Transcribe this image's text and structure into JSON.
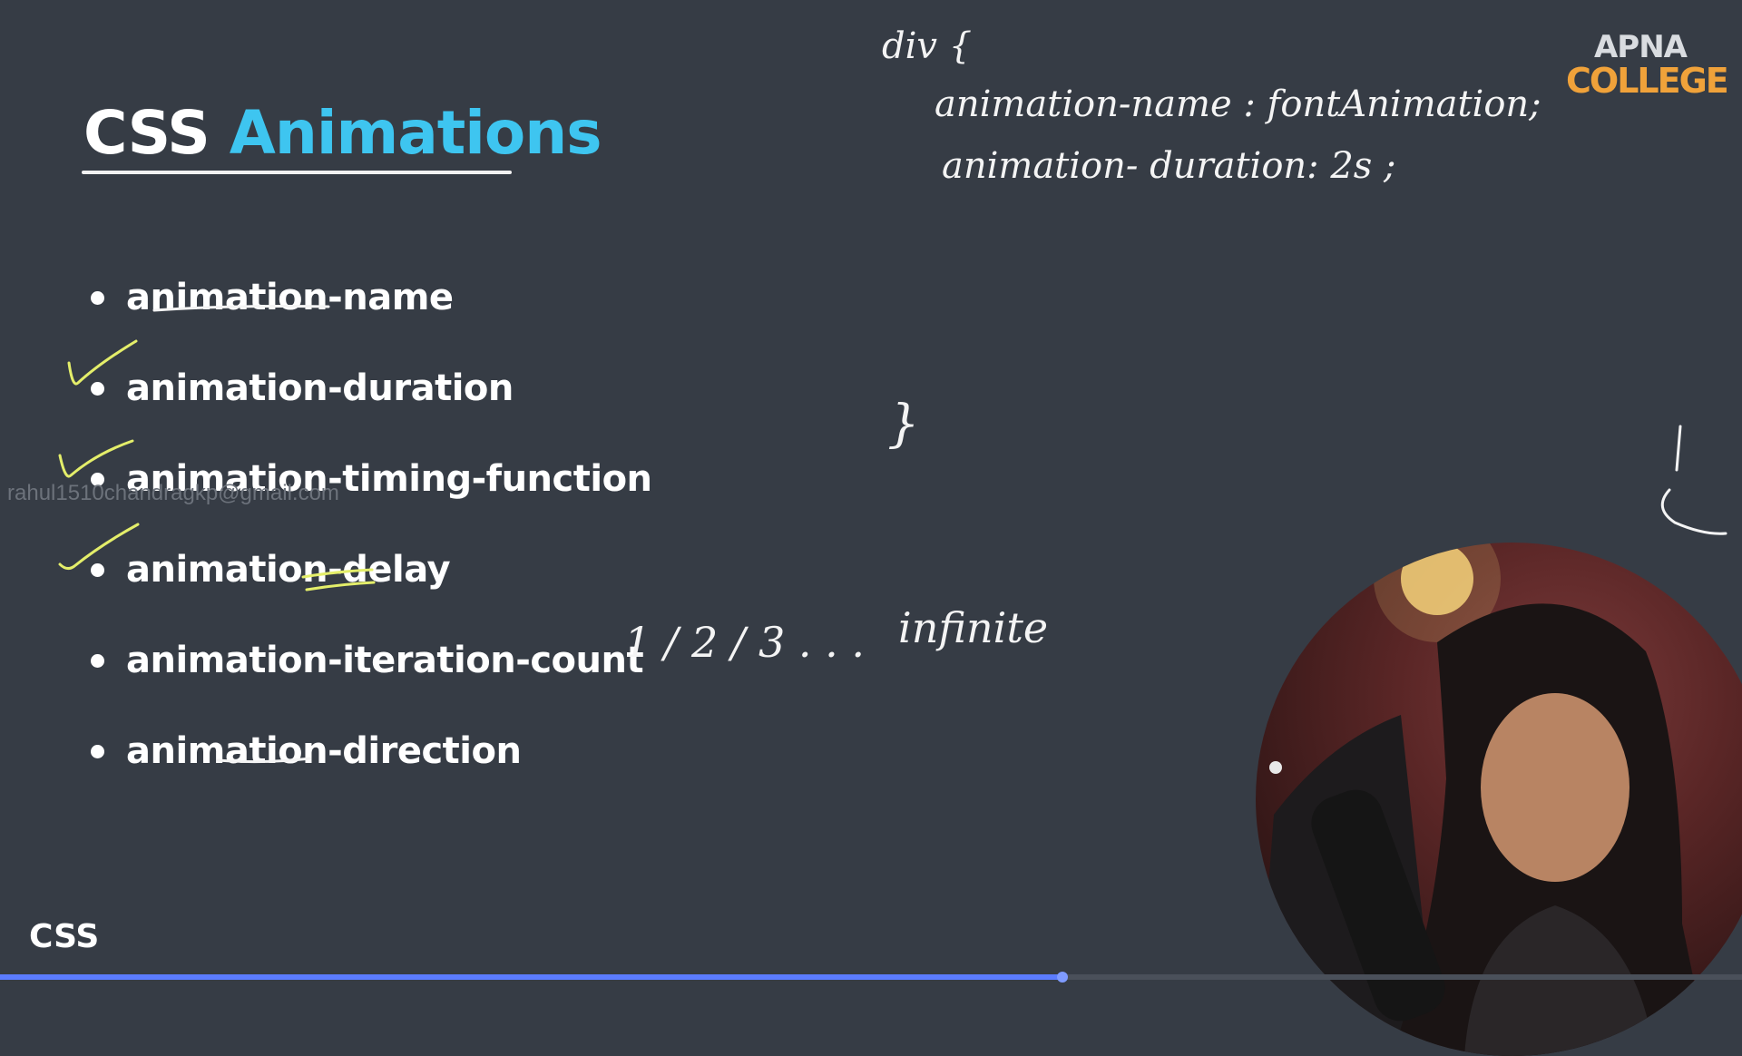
{
  "slide": {
    "title_main": "CSS",
    "title_highlight": "Animations",
    "properties": [
      "animation-name",
      "animation-duration",
      "animation-timing-function",
      "animation-delay",
      "animation-iteration-count",
      "animation-direction"
    ],
    "footer_label": "CSS",
    "watermark_email": "rahul1510chandragkp@gmail.com"
  },
  "logo": {
    "line1": "APNA",
    "line2": "COLLEGE"
  },
  "handwriting": {
    "selector_open": "div {",
    "line1": "animation-name :  fontAnimation;",
    "line2": "animation- duration:   2s ;",
    "selector_close": "}",
    "iteration_values": "1 / 2 / 3 . . .",
    "iteration_infinite": "infinite"
  },
  "video": {
    "progress": 0.61
  },
  "colors": {
    "background": "#363c45",
    "title_accent": "#3ec5f0",
    "annotation_yellow": "#e4ee6a",
    "logo_orange": "#f0a23a"
  }
}
